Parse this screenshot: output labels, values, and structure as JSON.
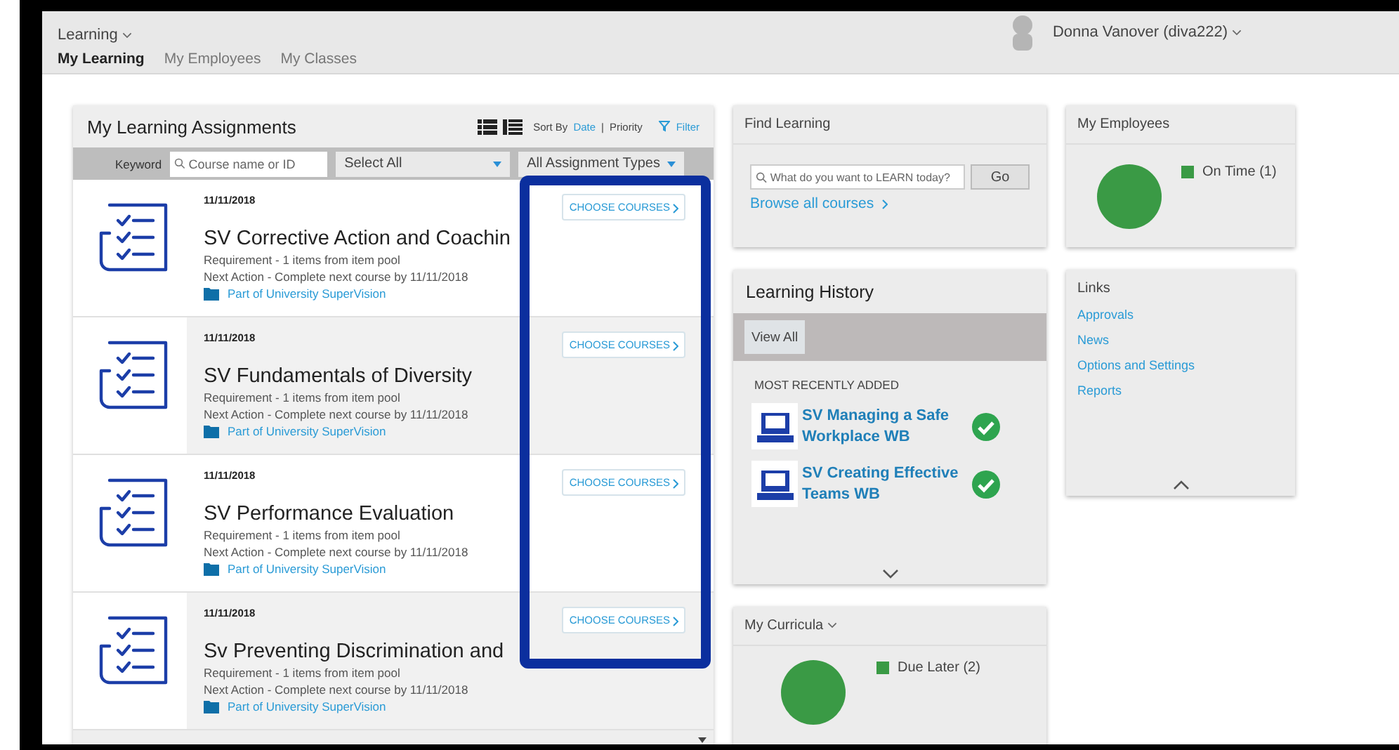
{
  "header": {
    "app_menu": "Learning",
    "user_name": "Donna Vanover (diva222)",
    "tabs": [
      {
        "label": "My Learning",
        "selected": true
      },
      {
        "label": "My Employees",
        "selected": false
      },
      {
        "label": "My Classes",
        "selected": false
      }
    ]
  },
  "assignments": {
    "title": "My Learning Assignments",
    "sort_label": "Sort By",
    "sort_options": [
      {
        "label": "Date",
        "selected": true
      },
      {
        "label": "Priority",
        "selected": false
      }
    ],
    "sort_separator": "|",
    "filter": "Filter",
    "keyword_label": "Keyword",
    "keyword_placeholder": "Course name or ID",
    "status_select": "Select All",
    "type_select": "All Assignment Types",
    "items": [
      {
        "date": "11/11/2018",
        "title": "SV Corrective Action and Coachin",
        "requirement": "Requirement - 1 items from item pool",
        "next_action": "Next Action - Complete next course by 11/11/2018",
        "curriculum": "Part of University SuperVision",
        "button": "CHOOSE COURSES"
      },
      {
        "date": "11/11/2018",
        "title": "SV Fundamentals of Diversity",
        "requirement": "Requirement - 1 items from item pool",
        "next_action": "Next Action - Complete next course by 11/11/2018",
        "curriculum": "Part of University SuperVision",
        "button": "CHOOSE COURSES"
      },
      {
        "date": "11/11/2018",
        "title": "SV Performance Evaluation",
        "requirement": "Requirement - 1 items from item pool",
        "next_action": "Next Action - Complete next course by 11/11/2018",
        "curriculum": "Part of University SuperVision",
        "button": "CHOOSE COURSES"
      },
      {
        "date": "11/11/2018",
        "title": "Sv Preventing Discrimination and",
        "requirement": "Requirement - 1 items from item pool",
        "next_action": "Next Action - Complete next course by 11/11/2018",
        "curriculum": "Part of University SuperVision",
        "button": "CHOOSE COURSES"
      }
    ]
  },
  "find_learning": {
    "title": "Find Learning",
    "placeholder": "What do you want to LEARN today?",
    "go": "Go",
    "browse": "Browse all courses"
  },
  "my_employees": {
    "title": "My Employees",
    "legend": [
      {
        "label": "On Time (1)",
        "color": "#3a9a45"
      }
    ]
  },
  "learning_history": {
    "title": "Learning History",
    "view_all": "View All",
    "section_label": "MOST RECENTLY ADDED",
    "items": [
      {
        "title": "SV Managing a Safe Workplace WB",
        "completed": true
      },
      {
        "title": "SV Creating Effective Teams WB",
        "completed": true
      }
    ]
  },
  "links": {
    "title": "Links",
    "items": [
      "Approvals",
      "News",
      "Options and Settings",
      "Reports"
    ]
  },
  "my_curricula": {
    "title": "My Curricula",
    "legend": [
      {
        "label": "Due Later (2)",
        "color": "#3a9a45"
      }
    ]
  }
}
